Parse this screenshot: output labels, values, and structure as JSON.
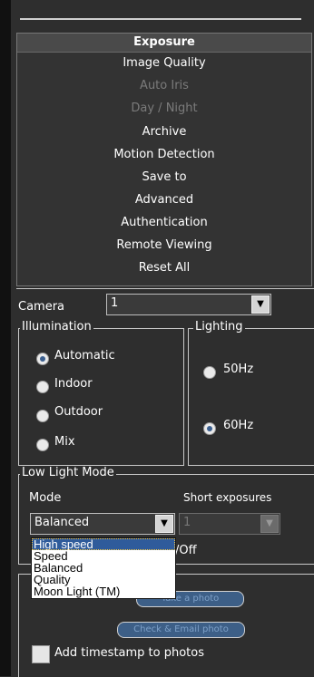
{
  "menu": {
    "items": [
      {
        "label": "Exposure",
        "state": "selected"
      },
      {
        "label": "Image Quality",
        "state": "normal"
      },
      {
        "label": "Auto Iris",
        "state": "disabled"
      },
      {
        "label": "Day / Night",
        "state": "disabled"
      },
      {
        "label": "Archive",
        "state": "normal"
      },
      {
        "label": "Motion Detection",
        "state": "normal"
      },
      {
        "label": "Save to",
        "state": "normal"
      },
      {
        "label": "Advanced",
        "state": "normal"
      },
      {
        "label": "Authentication",
        "state": "normal"
      },
      {
        "label": "Remote Viewing",
        "state": "normal"
      },
      {
        "label": "Reset All",
        "state": "normal"
      }
    ]
  },
  "camera": {
    "label": "Camera",
    "value": "1"
  },
  "illumination": {
    "legend": "Illumination",
    "options": [
      "Automatic",
      "Indoor",
      "Outdoor",
      "Mix"
    ],
    "selected": "Automatic"
  },
  "lighting": {
    "legend": "Lighting",
    "options": [
      "50Hz",
      "60Hz"
    ],
    "selected": "60Hz"
  },
  "low_light": {
    "legend": "Low Light Mode",
    "mode_label": "Mode",
    "mode_value": "Balanced",
    "short_exposures_label": "Short exposures",
    "short_exposures_value": "1",
    "partial_label": "/Off"
  },
  "dropdown": {
    "items": [
      "High speed",
      "Speed",
      "Balanced",
      "Quality",
      "Moon Light (TM)"
    ],
    "highlighted": "High speed"
  },
  "photos": {
    "button1": "Take a photo",
    "button2": "Check & Email photo",
    "timestamp_label": "Add timestamp to photos"
  }
}
